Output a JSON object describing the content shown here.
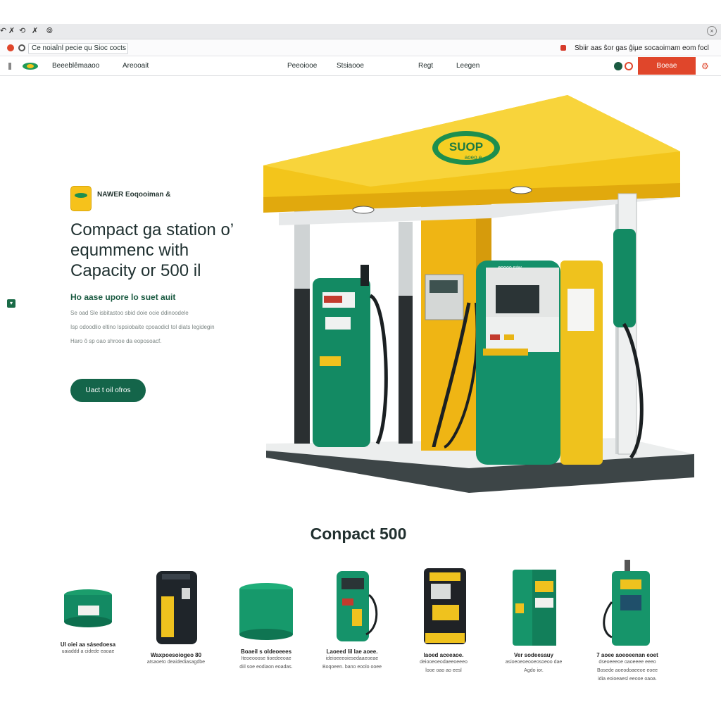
{
  "browser": {
    "controls": [
      "↶",
      "✗",
      "⟲",
      "✗",
      "⦾"
    ],
    "address_url": "Ce noiaînl pecie qu Sioc cocts",
    "search_text": "Sbiir aas ŝor gas ĝiµe socaoimam eom focl",
    "accent_color": "#d63b2a"
  },
  "nav": {
    "links": [
      "Beeeblêmaaoo",
      "Areooait",
      "Peeoiooe",
      "Stsiaooe",
      "Regt",
      "Leegen"
    ],
    "cta_label": "Boeae",
    "cta_color": "#e0462b",
    "icons": [
      "globe-icon",
      "record-icon",
      "settings-icon"
    ]
  },
  "hero": {
    "brand_name": "NAWER Eoqooiman &",
    "title_lines": [
      "Compact ga station o’",
      "eqummenc with",
      "Capacity or 500 il"
    ],
    "subtitle": "Ho aase upore lo suet auit",
    "body_lines": [
      "Se oad Sle isbitastoo sbid doie ocie ddinoodele",
      "Isp odoodlio eltino lspsiobaite cpoaodicl tol diats legidegin",
      "Haro õ sp oao shrooe da eoposoacf."
    ],
    "cta_label": "Uact t oil ofros",
    "primary_color": "#14654a",
    "canopy_logo": "SUOP",
    "canopy_logo_sub": "aoeo e",
    "pump_label": "eoooo sıiw"
  },
  "section": {
    "title": "Conpact 500"
  },
  "products": [
    {
      "icon": "round-tank-icon",
      "title": "Ul oiei aa sásedoesa",
      "desc": [
        "uaiaddd a cidede eaoae"
      ]
    },
    {
      "icon": "battery-unit-icon",
      "title": "Waxpoesoiogeo 80",
      "desc": [
        "atsaoeto deaidediasagdbe"
      ]
    },
    {
      "icon": "green-barrel-icon",
      "title": "Boaeil s oldeoeees",
      "desc": [
        "Iteoeooose tioedeeoae",
        "diil soe eodiaon eoadas."
      ]
    },
    {
      "icon": "dispenser-icon",
      "title": "Laoeed lil lae aoee.",
      "desc": [
        "ideioeeeoiesedaaeoeae",
        "Boqoeen. bano eoolo ooee"
      ]
    },
    {
      "icon": "payment-kiosk-icon",
      "title": "laoed aceeaoe.",
      "desc": [
        "deiooeoeodaeeoeeeo",
        "looe oao ao eesl"
      ]
    },
    {
      "icon": "cabinet-icon",
      "title": "Ver sodeesauy",
      "desc": [
        "asioeoeoeooeosoeoo dae",
        "Agdo ior."
      ]
    },
    {
      "icon": "fuel-pump-icon",
      "title": "7 aoee aoeoeenan eoet",
      "desc": [
        "dseoeeeoe oaoeeee eeeo",
        "Bosede aoeodoaeeoe eoee",
        "idia eoioeaesl eeooe oaoa."
      ]
    }
  ]
}
